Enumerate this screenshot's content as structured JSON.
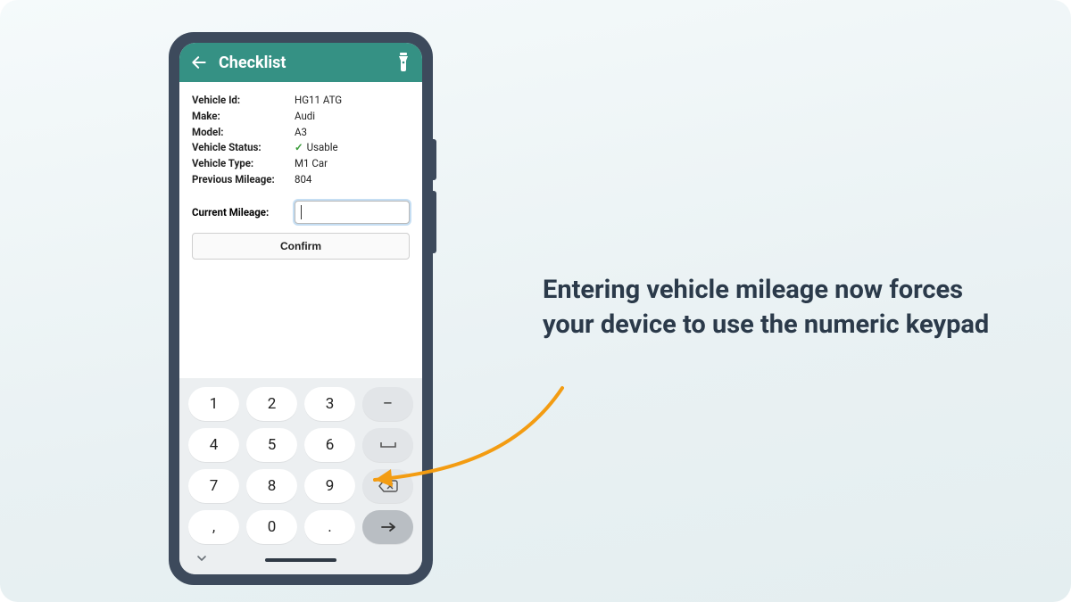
{
  "appbar": {
    "title": "Checklist"
  },
  "details": {
    "vehicle_id_label": "Vehicle Id:",
    "vehicle_id_value": "HG11 ATG",
    "make_label": "Make:",
    "make_value": "Audi",
    "model_label": "Model:",
    "model_value": "A3",
    "status_label": "Vehicle Status:",
    "status_value": "Usable",
    "type_label": "Vehicle Type:",
    "type_value": "M1 Car",
    "prev_mileage_label": "Previous Mileage:",
    "prev_mileage_value": "804"
  },
  "mileage": {
    "label": "Current Mileage:",
    "value": ""
  },
  "confirm_label": "Confirm",
  "keypad": {
    "k1": "1",
    "k2": "2",
    "k3": "3",
    "k4": "4",
    "k5": "5",
    "k6": "6",
    "k7": "7",
    "k8": "8",
    "k9": "9",
    "comma": ",",
    "k0": "0",
    "dot": ".",
    "dash": "–"
  },
  "annotation_text": "Entering vehicle mileage now forces your device to use the numeric keypad",
  "colors": {
    "accent": "#359184",
    "arrow": "#f39c12",
    "frame": "#3d4a5c"
  }
}
